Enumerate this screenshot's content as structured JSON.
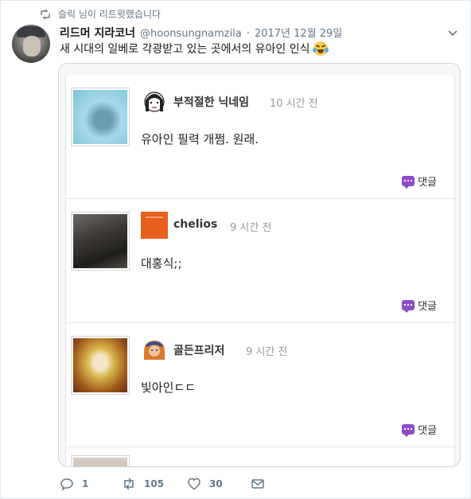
{
  "retweet_line": {
    "text": "슬릭 님이 리트윗했습니다",
    "icon": "retweet-icon"
  },
  "author": {
    "display_name": "리드머 지라코너",
    "handle": "@hoonsungnamzila",
    "separator": "·",
    "date": "2017년 12월 29일"
  },
  "tweet": {
    "text": "새 시대의 일베로 각광받고 있는 곳에서의 유아인 인식",
    "emoji": "face-with-tears-of-joy"
  },
  "comments": [
    {
      "name": "부적절한 닉네임",
      "time": "10 시간 전",
      "body": "유아인 필력 개쩜. 원래.",
      "reply_label": "댓글",
      "thumb_color": "#7cc4d9",
      "avatar": "cartoon-face-icon"
    },
    {
      "name": "chelios",
      "time": "9 시간 전",
      "body": "대홍식;;",
      "reply_label": "댓글",
      "thumb_color": "#3d3a36",
      "avatar": "orange-square-icon"
    },
    {
      "name": "골든프리저",
      "time": "9 시간 전",
      "body": "빛아인ㄷㄷ",
      "reply_label": "댓글",
      "thumb_color": "#c79b27",
      "avatar": "golden-character-icon"
    }
  ],
  "actions": {
    "reply_count": "1",
    "retweet_count": "105",
    "like_count": "30"
  },
  "colors": {
    "accent_purple": "#8e4cc7",
    "muted": "#657786",
    "chelios_orange": "#e8601c"
  }
}
